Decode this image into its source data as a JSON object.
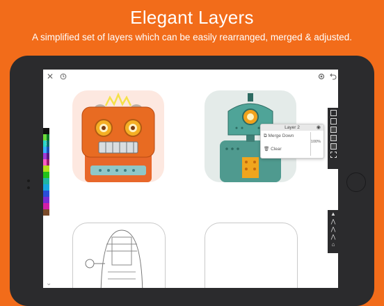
{
  "header": {
    "title": "Elegant Layers",
    "subtitle": "A simplified set of layers which can be easily rearranged, merged & adjusted."
  },
  "toolbar": {
    "close_icon": "close-icon",
    "history_icon": "history-icon",
    "settings_icon": "settings-icon",
    "undo_icon": "undo-icon"
  },
  "palette": {
    "colors": [
      "#111111",
      "#ffffff",
      "#e8162b",
      "#f26722",
      "#f7a21b",
      "#ffe31a",
      "#b4e01c",
      "#22c21b",
      "#1fb6a3",
      "#18a8e0",
      "#2a4fd8",
      "#7b2bd3",
      "#d21fa8",
      "#7a4a2a"
    ],
    "pairs": [
      [
        "#6bdc3a",
        "#0b7a2a"
      ],
      [
        "#2bd7c8",
        "#0f6e6a"
      ],
      [
        "#3ab1ff",
        "#1d4fb4"
      ],
      [
        "#a13bd9",
        "#5a1b7e"
      ],
      [
        "#ff5cc6",
        "#9b1a6d"
      ]
    ]
  },
  "layers_panel": {
    "title": "Layer 2",
    "merge_label": "Merge Down",
    "clear_label": "Clear",
    "opacity": "100%",
    "eye_icon": "eye-icon",
    "merge_icon": "merge-icon",
    "trash_icon": "trash-icon"
  },
  "side_toolbar": {
    "icons": [
      "layer-icon",
      "layer-icon",
      "brush-layer-icon",
      "brush-layer-icon",
      "brush-layer-icon",
      "grid-icon"
    ]
  },
  "brush_toolbar": {
    "icons": [
      "pencil-icon",
      "pen-icon",
      "marker-icon",
      "brush-icon",
      "airbrush-icon"
    ]
  },
  "colors": {
    "background": "#f26c1a",
    "tablet": "#2b2b2d",
    "accent": "#6fb4c1"
  }
}
